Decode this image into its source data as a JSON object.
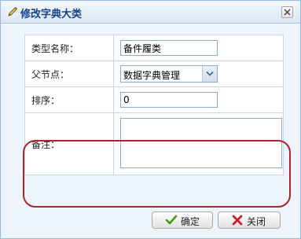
{
  "dialog": {
    "title": "修改字典大类",
    "icons": {
      "title": "pencil-icon",
      "close": "close-icon"
    }
  },
  "form": {
    "type_name": {
      "label": "类型名称：",
      "value": "备件履类"
    },
    "parent_node": {
      "label": "父节点：",
      "selected": "数据字典管理"
    },
    "sort": {
      "label": "排序：",
      "value": "0"
    },
    "remark": {
      "label": "备注：",
      "value": ""
    }
  },
  "buttons": {
    "ok": {
      "label": "确定",
      "icon": "check-icon"
    },
    "close": {
      "label": "关闭",
      "icon": "cross-icon"
    }
  },
  "colors": {
    "title_text": "#15428b",
    "border": "#99bbe8",
    "highlight": "#b0222a",
    "ok_icon": "#3aa012",
    "close_icon": "#c8222a"
  }
}
